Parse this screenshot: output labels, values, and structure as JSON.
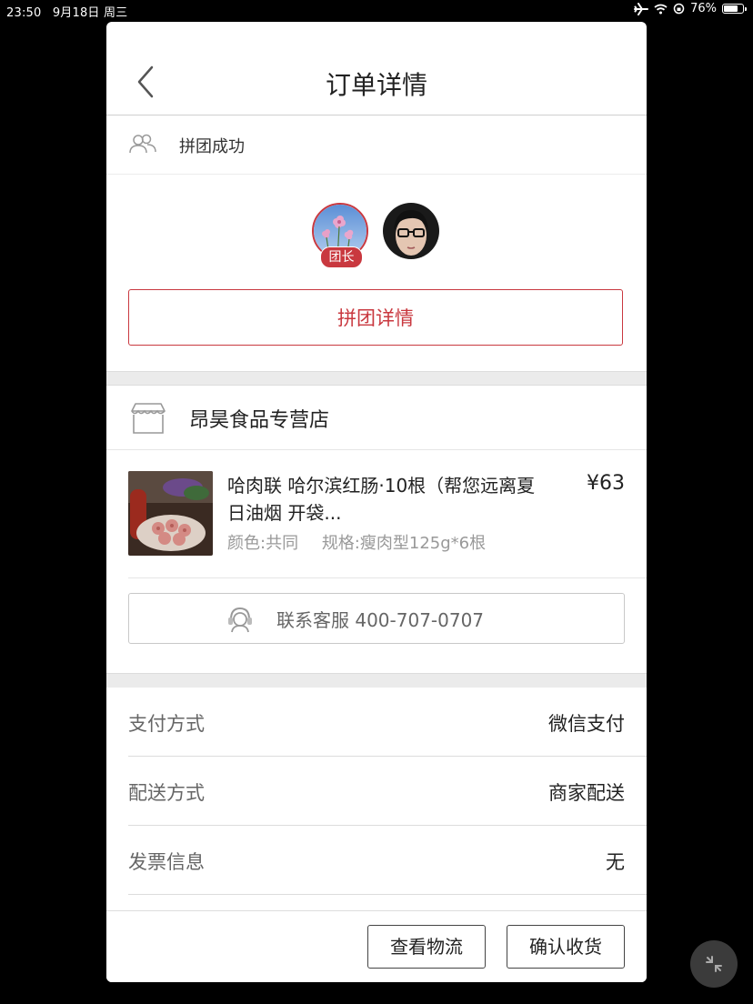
{
  "status_bar": {
    "time": "23:50",
    "date": "9月18日 周三",
    "battery": "76%",
    "battery_level": 0.76,
    "icons": [
      "airplane-icon",
      "wifi-icon",
      "orientation-lock-icon",
      "battery-icon"
    ]
  },
  "header": {
    "title": "订单详情",
    "back_icon": "chevron-left-icon"
  },
  "group": {
    "status": "拼团成功",
    "leader_badge": "团长",
    "detail_button": "拼团详情"
  },
  "shop": {
    "name": "昂昊食品专营店",
    "icon": "store-icon"
  },
  "product": {
    "title": "哈肉联 哈尔滨红肠·10根（帮您远离夏日油烟 开袋...",
    "price": "¥63",
    "color": "颜色:共同",
    "spec": "规格:瘦肉型125g*6根"
  },
  "service": {
    "label": "联系客服 400-707-0707",
    "icon": "customer-service-icon"
  },
  "info": [
    {
      "key": "支付方式",
      "value": "微信支付"
    },
    {
      "key": "配送方式",
      "value": "商家配送"
    },
    {
      "key": "发票信息",
      "value": "无"
    }
  ],
  "actions": {
    "logistics": "查看物流",
    "confirm": "确认收货"
  },
  "colors": {
    "accent": "#c9383f",
    "background": "#000000",
    "panel": "#ffffff",
    "gap": "#ebebeb"
  }
}
